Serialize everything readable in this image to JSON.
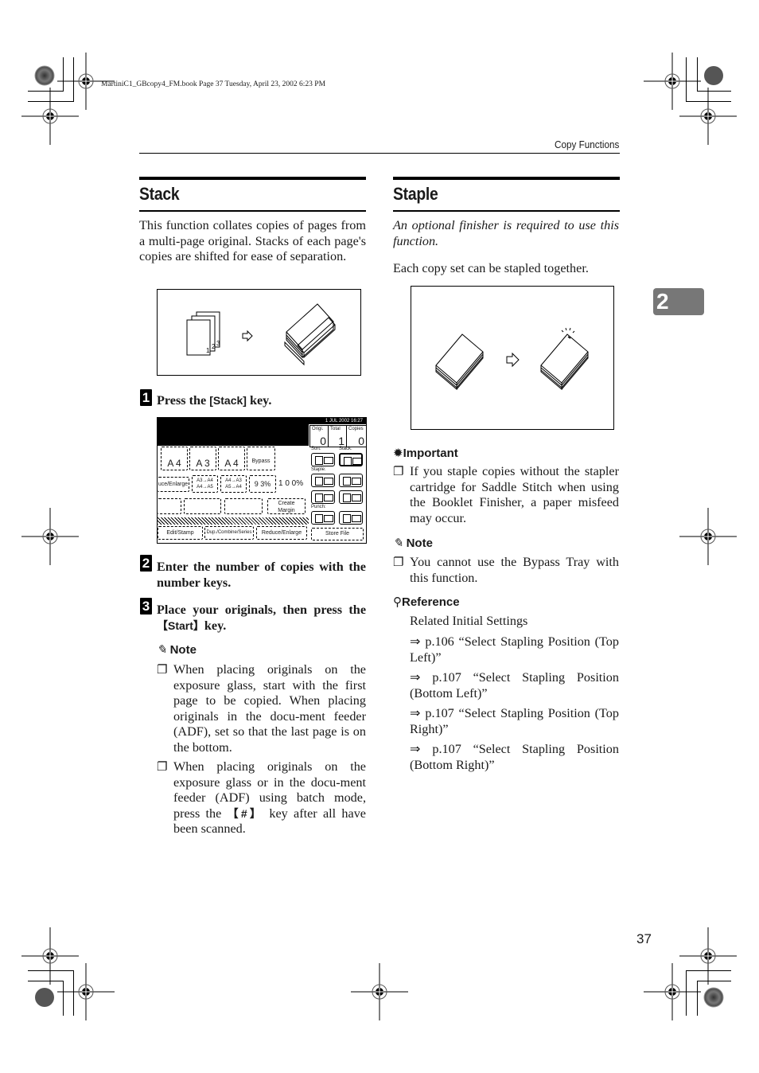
{
  "print_marks": {
    "book_info": "MartiniC1_GBcopy4_FM.book  Page 37  Tuesday, April 23, 2002  6:23 PM"
  },
  "header": {
    "running_head": "Copy Functions"
  },
  "chapter_tab": {
    "number": "2",
    "color": "#777777"
  },
  "stack": {
    "title": "Stack",
    "intro": "This function collates copies of pages from a multi-page original. Stacks of each page's copies are shifted for ease of separation.",
    "figure": {
      "page_labels": [
        "1",
        "2",
        "3"
      ],
      "arrow": "outline-right-arrow"
    },
    "steps": [
      {
        "number": "1",
        "text_before": "Press the ",
        "key": "[Stack]",
        "text_after": " key."
      },
      {
        "number": "2",
        "text": "Enter the number of copies with the number keys."
      },
      {
        "number": "3",
        "text_before": "Place your originals, then press the ",
        "key": "【Start】",
        "text_after": "key."
      }
    ],
    "panel": {
      "date": "1  JUL   2002 16:27",
      "counters": [
        {
          "label": "Origi.",
          "value": "0"
        },
        {
          "label": "Total",
          "value": "1"
        },
        {
          "label": "Copies",
          "value": "0"
        }
      ],
      "paper_buttons": [
        {
          "tray": "2",
          "size": "A 4"
        },
        {
          "tray": "3",
          "size": "A 3"
        },
        {
          "tray": "T",
          "size": "A 4"
        },
        {
          "tray": "",
          "size": "Bypass"
        }
      ],
      "reduce_enlarge_label": "uce/Enlarge",
      "ratio_buttons": [
        "A3→A4\nA4→A5",
        "A4→A3\nA5→A4",
        "9 3%"
      ],
      "ratio_value": "1 0 0%",
      "create_margin": "Create Margin",
      "sort_label": "Sort:",
      "stack_label": "Stack:",
      "staple_label": "Staple:",
      "punch_label": "Punch:",
      "tabs": [
        "Edit/Stamp",
        "Dup./Combine/Series",
        "Reduce/Enlarge"
      ],
      "store_file": "Store File"
    },
    "note": {
      "heading": "Note",
      "items": [
        "When placing originals on the exposure glass, start with the first page to be copied. When placing originals in the docu-ment feeder (ADF), set so that the last page is on the bottom.",
        {
          "before": "When placing originals on the exposure glass or in the docu-ment feeder (ADF) using batch mode, press the ",
          "key": "【#】",
          "after": " key after all have been scanned."
        }
      ]
    }
  },
  "staple": {
    "title": "Staple",
    "requirement": "An optional finisher is required to use this function.",
    "intro": "Each copy set can be stapled together.",
    "important": {
      "heading": "Important",
      "items": [
        "If you staple copies without the stapler cartridge for Saddle Stitch when using the Booklet Finisher, a paper misfeed may occur."
      ]
    },
    "note": {
      "heading": "Note",
      "items": [
        "You cannot use the Bypass Tray with this function."
      ]
    },
    "reference": {
      "heading": "Reference",
      "intro": "Related Initial Settings",
      "links": [
        "⇒ p.106 “Select Stapling Position (Top Left)”",
        "⇒ p.107 “Select Stapling Position (Bottom Left)”",
        "⇒ p.107 “Select Stapling Position (Top Right)”",
        "⇒ p.107 “Select Stapling Position (Bottom Right)”"
      ]
    }
  },
  "footer": {
    "page_number": "37"
  }
}
